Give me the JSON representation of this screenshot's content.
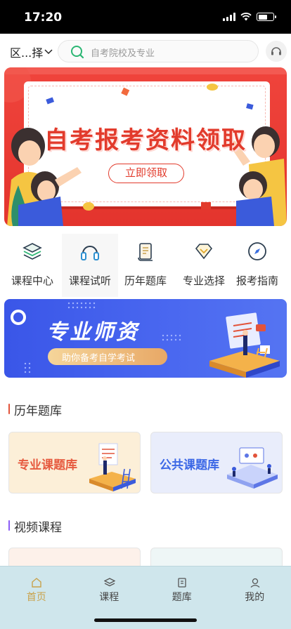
{
  "status_bar": {
    "time": "17:20",
    "battery_level": 0.6
  },
  "header": {
    "region_label": "区...择",
    "search_placeholder": "自考院校及专业"
  },
  "banner": {
    "title": "自考报考资料领取",
    "button_label": "立即领取",
    "accent_color": "#e23b2c"
  },
  "quick_menu": {
    "items": [
      {
        "label": "课程中心",
        "icon": "layers-icon"
      },
      {
        "label": "课程试听",
        "icon": "headphones-icon"
      },
      {
        "label": "历年题库",
        "icon": "scroll-icon"
      },
      {
        "label": "专业选择",
        "icon": "diamond-icon"
      },
      {
        "label": "报考指南",
        "icon": "compass-icon"
      }
    ]
  },
  "teacher_banner": {
    "title": "专业师资",
    "subtitle": "助你备考自学考试"
  },
  "sections": {
    "question_bank": {
      "title": "历年题库",
      "cards": [
        {
          "label": "专业课题库"
        },
        {
          "label": "公共课题库"
        }
      ]
    },
    "video_courses": {
      "title": "视频课程"
    }
  },
  "tabbar": {
    "items": [
      {
        "label": "首页",
        "icon": "home-icon"
      },
      {
        "label": "课程",
        "icon": "layers-icon"
      },
      {
        "label": "题库",
        "icon": "book-icon"
      },
      {
        "label": "我的",
        "icon": "user-icon"
      }
    ],
    "active_color": "#c9a24b"
  }
}
